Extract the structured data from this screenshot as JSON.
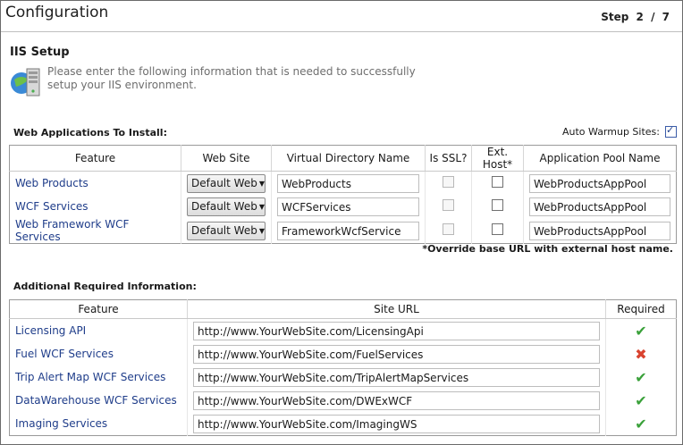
{
  "header": {
    "title": "Configuration",
    "step_label": "Step",
    "step_current": "2",
    "step_sep": "/",
    "step_total": "7"
  },
  "section": {
    "title": "IIS Setup",
    "description": "Please enter the following information that is needed to successfully setup your IIS environment.",
    "icon": "server-icon"
  },
  "web_apps": {
    "label": "Web Applications To Install:",
    "auto_warmup_label": "Auto Warmup Sites:",
    "auto_warmup_checked": true,
    "columns": [
      "Feature",
      "Web Site",
      "Virtual Directory Name",
      "Is SSL?",
      "Ext. Host*",
      "Application Pool Name"
    ],
    "rows": [
      {
        "feature": "Web Products",
        "website": "Default Web",
        "vdir": "WebProducts",
        "ssl": false,
        "ext_host": false,
        "pool": "WebProductsAppPool"
      },
      {
        "feature": "WCF Services",
        "website": "Default Web",
        "vdir": "WCFServices",
        "ssl": false,
        "ext_host": false,
        "pool": "WebProductsAppPool"
      },
      {
        "feature": "Web Framework WCF Services",
        "website": "Default Web",
        "vdir": "FrameworkWcfService",
        "ssl": false,
        "ext_host": false,
        "pool": "WebProductsAppPool"
      }
    ],
    "note": "*Override base URL with external host name."
  },
  "additional": {
    "label": "Additional Required Information:",
    "columns": [
      "Feature",
      "Site URL",
      "Required"
    ],
    "rows": [
      {
        "feature": "Licensing API",
        "url": "http://www.YourWebSite.com/LicensingApi",
        "required": true,
        "mark": "✔"
      },
      {
        "feature": "Fuel WCF Services",
        "url": "http://www.YourWebSite.com/FuelServices",
        "required": false,
        "mark": "✖"
      },
      {
        "feature": "Trip Alert Map WCF Services",
        "url": "http://www.YourWebSite.com/TripAlertMapServices",
        "required": true,
        "mark": "✔"
      },
      {
        "feature": "DataWarehouse WCF Services",
        "url": "http://www.YourWebSite.com/DWExWCF",
        "required": true,
        "mark": "✔"
      },
      {
        "feature": "Imaging Services",
        "url": "http://www.YourWebSite.com/ImagingWS",
        "required": true,
        "mark": "✔"
      }
    ]
  },
  "colors": {
    "link": "#1f3d8a",
    "check_ok": "#3aa13a",
    "check_bad": "#d9432f"
  }
}
